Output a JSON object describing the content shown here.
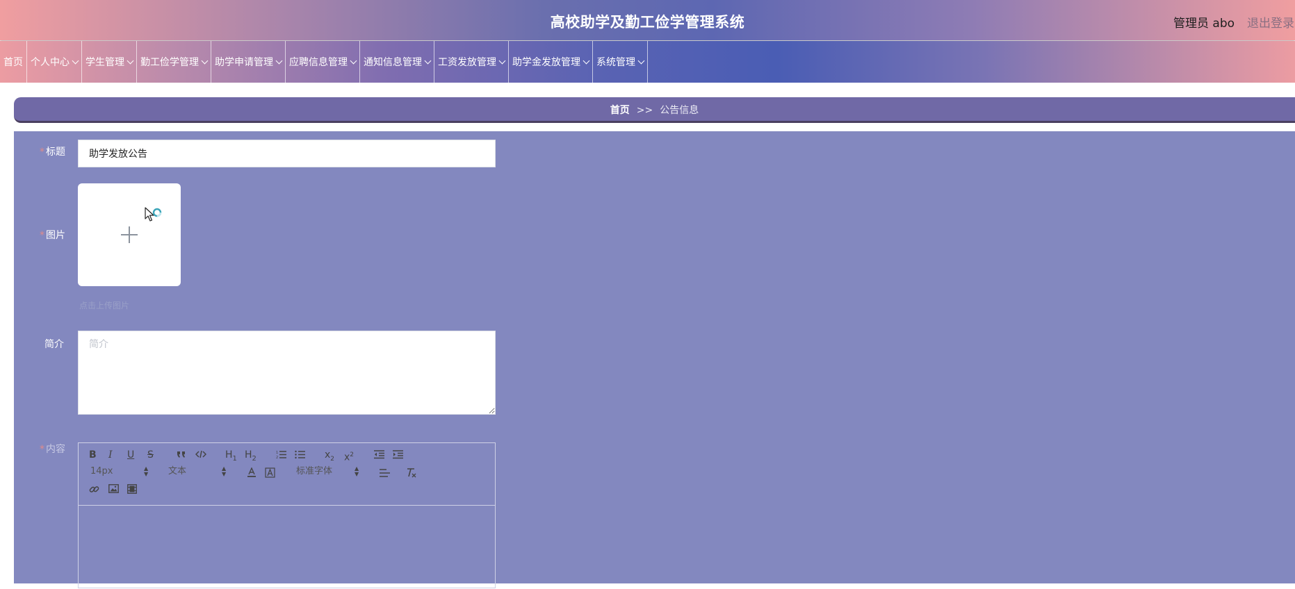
{
  "header": {
    "title": "高校助学及勤工俭学管理系统",
    "user": "管理员 abo",
    "logout": "退出登录"
  },
  "nav": {
    "items": [
      {
        "label": "首页",
        "has_dropdown": false
      },
      {
        "label": "个人中心",
        "has_dropdown": true
      },
      {
        "label": "学生管理",
        "has_dropdown": true
      },
      {
        "label": "勤工俭学管理",
        "has_dropdown": true
      },
      {
        "label": "助学申请管理",
        "has_dropdown": true
      },
      {
        "label": "应聘信息管理",
        "has_dropdown": true
      },
      {
        "label": "通知信息管理",
        "has_dropdown": true
      },
      {
        "label": "工资发放管理",
        "has_dropdown": true
      },
      {
        "label": "助学金发放管理",
        "has_dropdown": true
      },
      {
        "label": "系统管理",
        "has_dropdown": true
      }
    ]
  },
  "breadcrumb": {
    "home": "首页",
    "separator": ">>",
    "current": "公告信息"
  },
  "form": {
    "title": {
      "label": "标题",
      "required": true,
      "value": "助学发放公告"
    },
    "image": {
      "label": "图片",
      "required": true,
      "tip": "点击上传图片"
    },
    "intro": {
      "label": "简介",
      "placeholder": "简介",
      "value": ""
    },
    "content": {
      "label": "内容",
      "required": true
    }
  },
  "editor": {
    "toolbar": {
      "bold": "B",
      "italic": "I",
      "underline": "U",
      "strike": "S",
      "h1": "H1",
      "h2": "H2",
      "sub": "x2",
      "super": "x2",
      "font_size": "14px",
      "header_select": "文本",
      "font_family": "标准字体"
    }
  },
  "colors": {
    "accent": "#7069a6",
    "form_bg": "#8388bf",
    "required": "#e08b8b"
  }
}
